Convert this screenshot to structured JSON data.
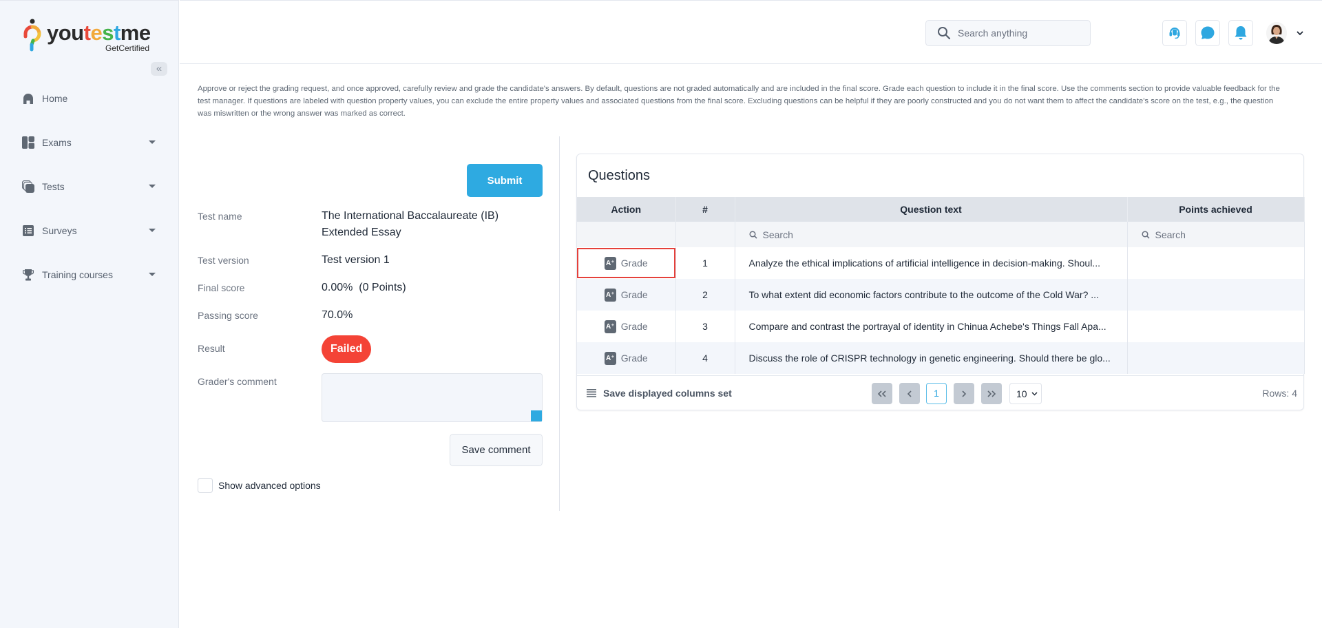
{
  "brand": {
    "name_parts": [
      "you",
      "t",
      "e",
      "s",
      "t",
      "me"
    ],
    "tagline": "GetCertified",
    "collapse_icon": "«"
  },
  "sidebar": {
    "items": [
      {
        "label": "Home",
        "icon": "home-icon",
        "has_caret": false
      },
      {
        "label": "Exams",
        "icon": "exams-icon",
        "has_caret": true
      },
      {
        "label": "Tests",
        "icon": "tests-icon",
        "has_caret": true
      },
      {
        "label": "Surveys",
        "icon": "surveys-icon",
        "has_caret": true
      },
      {
        "label": "Training courses",
        "icon": "trophy-icon",
        "has_caret": true
      }
    ]
  },
  "header": {
    "search_placeholder": "Search anything",
    "buttons": [
      "headset-icon",
      "chat-icon",
      "bell-icon"
    ]
  },
  "description": "Approve or reject the grading request, and once approved, carefully review and grade the candidate's answers. By default, questions are not graded automatically and are included in the final score. Grade each question to include it in the final score. Use the comments section to provide valuable feedback for the test manager. If questions are labeled with question property values, you can exclude the entire property values and associated questions from the final score. Excluding questions can be helpful if they are poorly constructed and you do not want them to affect the candidate's score on the test, e.g., the question was miswritten or the wrong answer was marked as correct.",
  "details": {
    "submit_label": "Submit",
    "test_name_label": "Test name",
    "test_name_line1": "The International Baccalaureate (IB)",
    "test_name_line2": "Extended Essay",
    "test_version_label": "Test version",
    "test_version": "Test version 1",
    "final_score_label": "Final score",
    "final_score": "0.00%  (0 Points)",
    "passing_score_label": "Passing score",
    "passing_score": "70.0%",
    "result_label": "Result",
    "result": "Failed",
    "comment_label": "Grader's comment",
    "comment_value": "",
    "save_comment_label": "Save comment",
    "advanced_label": "Show advanced options"
  },
  "questions": {
    "title": "Questions",
    "columns": [
      "Action",
      "#",
      "Question text",
      "Points achieved"
    ],
    "filter_placeholder": "Search",
    "rows": [
      {
        "action": "Grade",
        "num": "1",
        "text": "Analyze the ethical implications of artificial intelligence in decision-making. Shoul...",
        "points": ""
      },
      {
        "action": "Grade",
        "num": "2",
        "text": "To what extent did economic factors contribute to the outcome of the Cold War? ...",
        "points": ""
      },
      {
        "action": "Grade",
        "num": "3",
        "text": "Compare and contrast the portrayal of identity in Chinua Achebe's Things Fall Apa...",
        "points": ""
      },
      {
        "action": "Grade",
        "num": "4",
        "text": "Discuss the role of CRISPR technology in genetic engineering. Should there be glo...",
        "points": ""
      }
    ],
    "footer": {
      "save_columns_label": "Save displayed columns set",
      "first_label": "«",
      "prev_label": "‹",
      "current_page": "1",
      "next_label": "›",
      "last_label": "»",
      "page_size": "10",
      "rows_label": "Rows: 4"
    }
  },
  "colors": {
    "accent": "#2eaae1",
    "danger": "#f44336",
    "highlight": "#e5403a"
  }
}
